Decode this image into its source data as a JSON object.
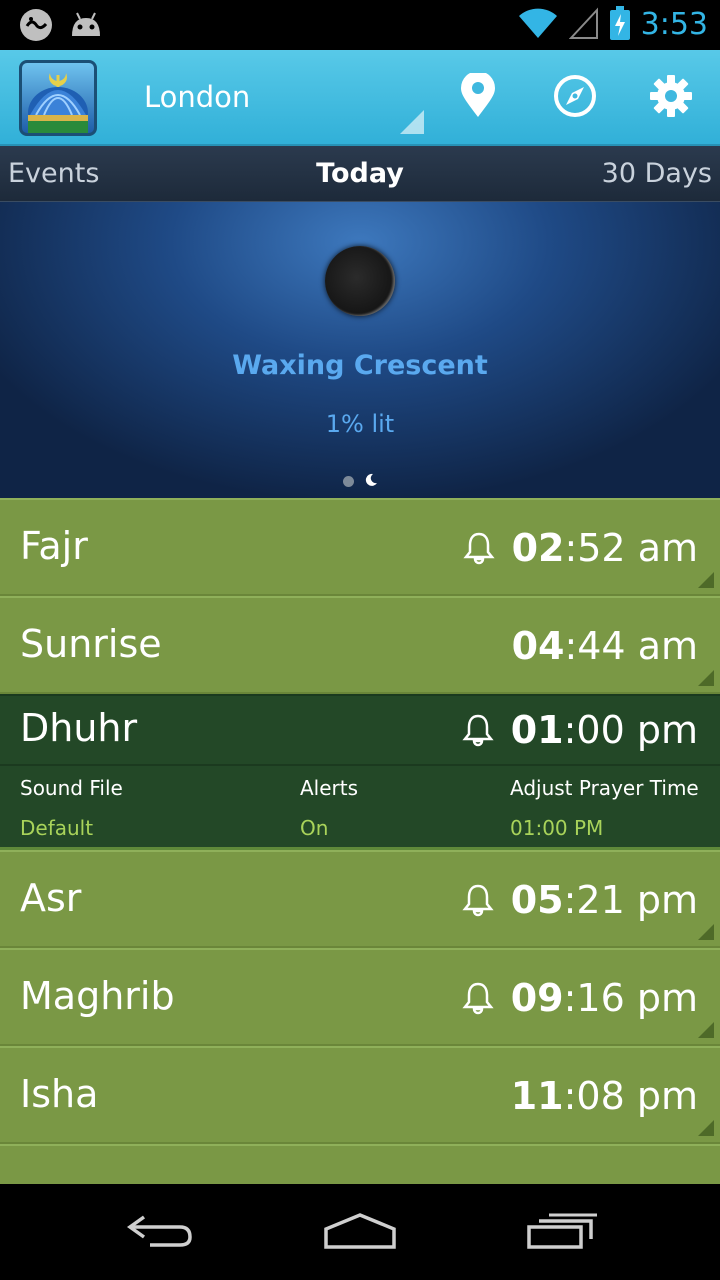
{
  "status_bar": {
    "time": "3:53",
    "icons": [
      "arabic-app-icon",
      "android-icon",
      "wifi-icon",
      "signal-icon",
      "battery-charging-icon"
    ]
  },
  "app_bar": {
    "city": "London",
    "actions": [
      "location-pin-icon",
      "compass-icon",
      "gear-icon"
    ]
  },
  "tabs": [
    {
      "label": "Events",
      "active": false
    },
    {
      "label": "Today",
      "active": true
    },
    {
      "label": "30 Days",
      "active": false
    }
  ],
  "moon": {
    "phase": "Waxing Crescent",
    "lit": "1% lit"
  },
  "prayers": [
    {
      "name": "Fajr",
      "hh": "02",
      "rest": ":52 am",
      "alarm": true
    },
    {
      "name": "Sunrise",
      "hh": "04",
      "rest": ":44 am",
      "alarm": false
    },
    {
      "name": "Dhuhr",
      "hh": "01",
      "rest": ":00 pm",
      "alarm": true
    },
    {
      "name": "Asr",
      "hh": "05",
      "rest": ":21 pm",
      "alarm": true
    },
    {
      "name": "Maghrib",
      "hh": "09",
      "rest": ":16 pm",
      "alarm": true
    },
    {
      "name": "Isha",
      "hh": "11",
      "rest": ":08 pm",
      "alarm": false
    }
  ],
  "dhuhr_details": {
    "sound_file_label": "Sound File",
    "sound_file_value": "Default",
    "alerts_label": "Alerts",
    "alerts_value": "On",
    "adjust_label": "Adjust Prayer Time",
    "adjust_value": "01:00 PM"
  },
  "colors": {
    "row_green": "#7a9845",
    "expanded_green": "#234827",
    "accent_blue": "#33b5e5",
    "detail_value_green": "#a9d35a"
  }
}
